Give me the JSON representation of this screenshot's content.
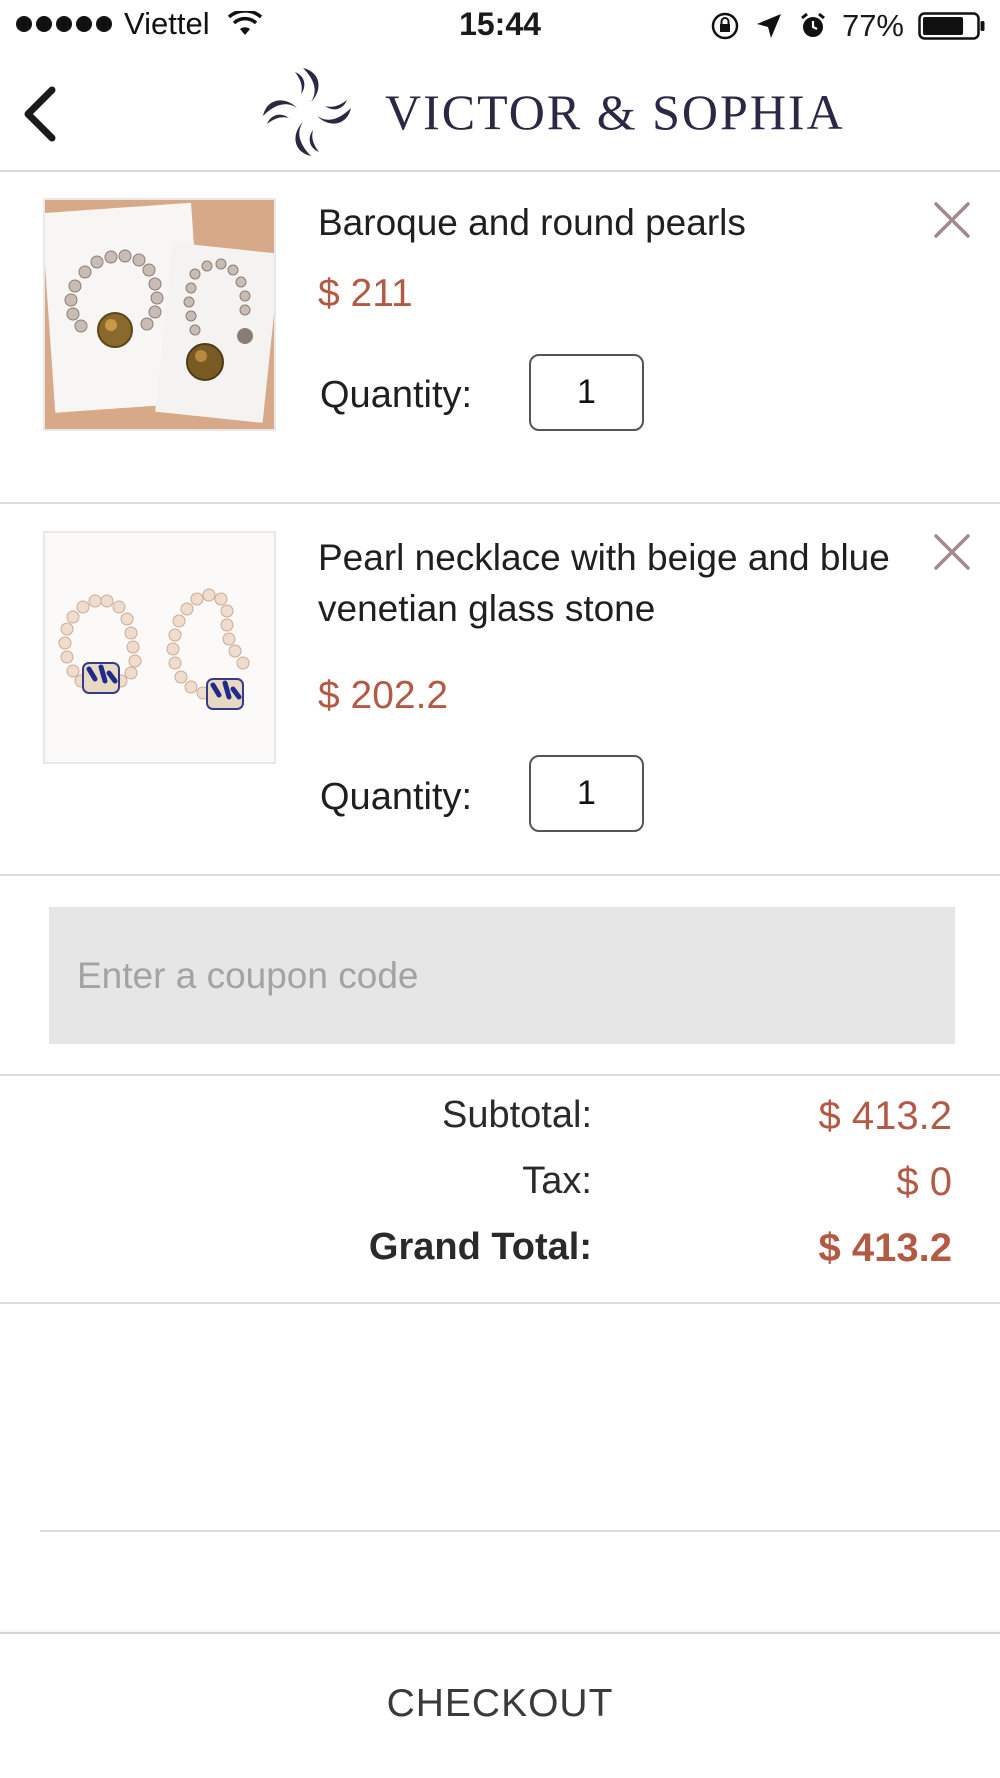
{
  "status_bar": {
    "carrier": "Viettel",
    "time": "15:44",
    "battery": "77%",
    "battery_level": 0.77,
    "icons": [
      "signal-icon",
      "wifi-icon",
      "orientation-lock-icon",
      "location-icon",
      "alarm-icon",
      "battery-icon"
    ]
  },
  "header": {
    "brand": "VICTOR & SOPHIA",
    "back_icon": "chevron-left-icon",
    "logo_color": "#2d2744"
  },
  "cart": {
    "quantity_label": "Quantity:",
    "remove_icon": "close-icon",
    "items": [
      {
        "title": "Baroque and round pearls",
        "price": "$ 211",
        "quantity": "1"
      },
      {
        "title": "Pearl necklace with beige and blue venetian glass stone",
        "price": "$ 202.2",
        "quantity": "1"
      }
    ]
  },
  "coupon": {
    "placeholder": "Enter a coupon code"
  },
  "totals": {
    "subtotal_label": "Subtotal:",
    "subtotal_value": "$ 413.2",
    "tax_label": "Tax:",
    "tax_value": "$ 0",
    "grand_label": "Grand Total:",
    "grand_value": "$ 413.2"
  },
  "checkout": {
    "label": "CHECKOUT"
  },
  "colors": {
    "price": "#b35a44",
    "brand": "#2d2744",
    "coupon_bg": "#e6e6e6",
    "divider": "#dcdcdc"
  }
}
